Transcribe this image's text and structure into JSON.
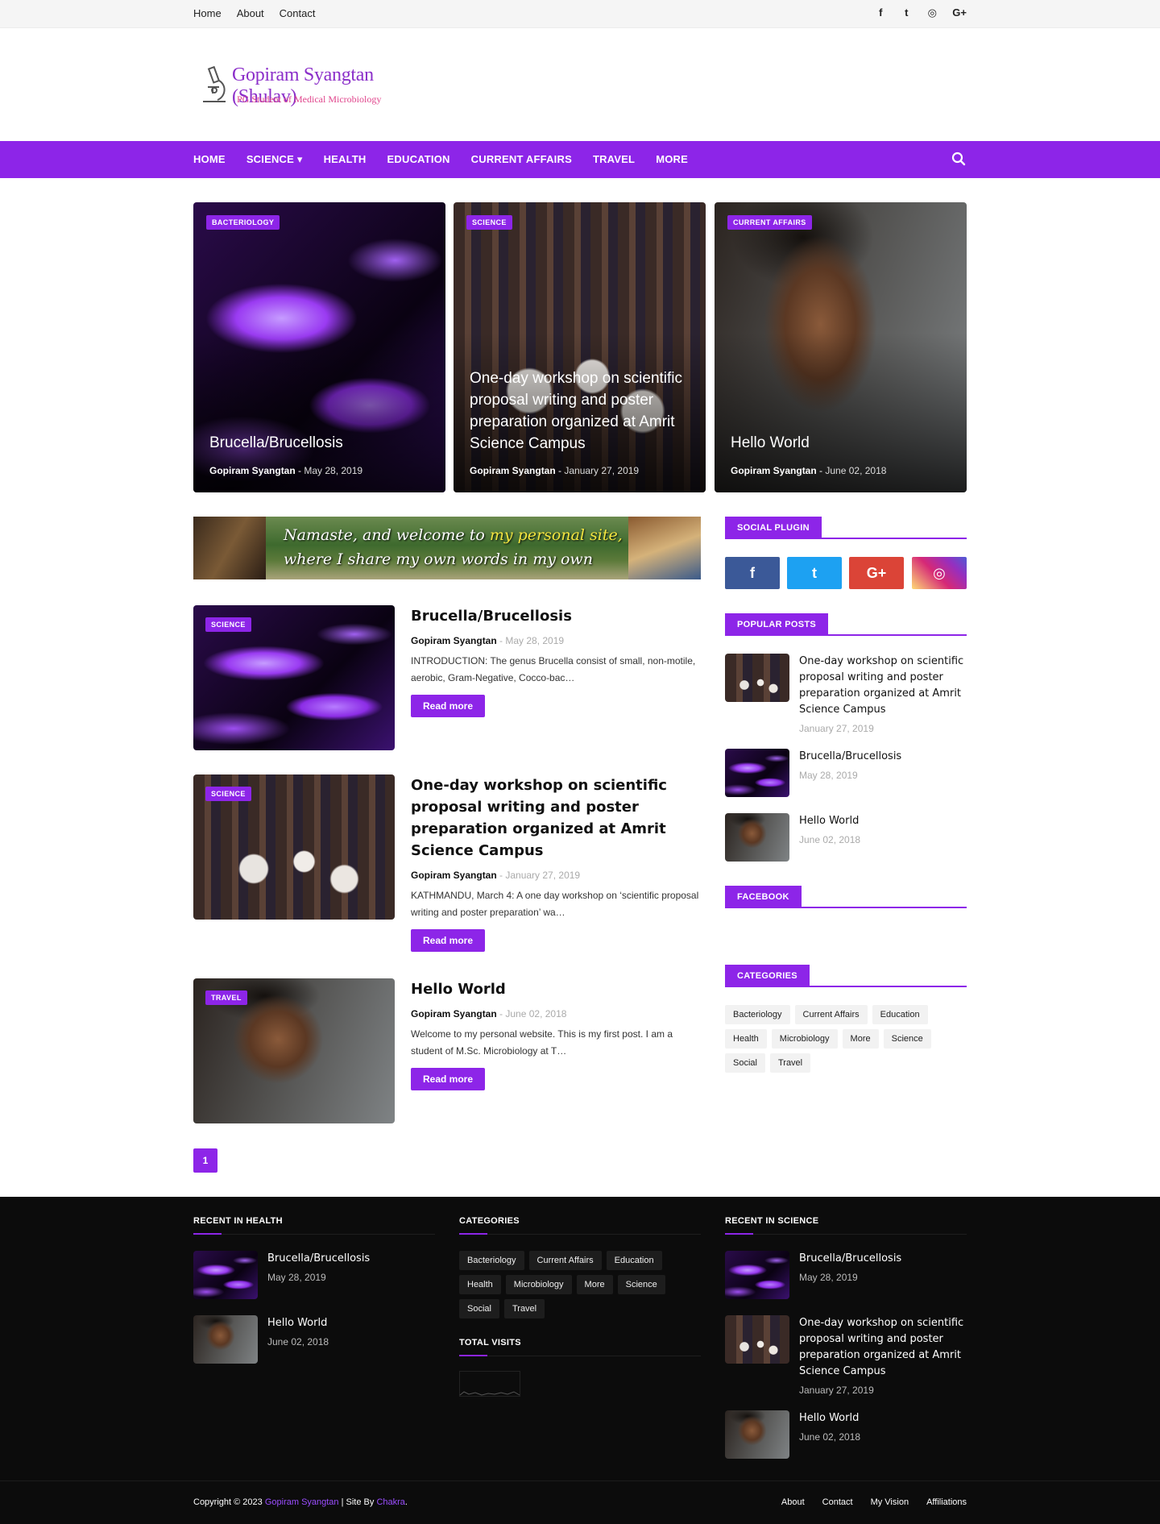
{
  "topbar": {
    "links": [
      "Home",
      "About",
      "Contact"
    ],
    "social_icons": [
      "facebook-icon",
      "twitter-icon",
      "instagram-icon",
      "google-plus-icon"
    ],
    "social_glyphs": [
      "f",
      "t",
      "◎",
      "G+"
    ]
  },
  "logo": {
    "title": "Gopiram Syangtan (Shulav)",
    "subtitle": "PG Student of Medical Microbiology"
  },
  "mainnav": {
    "items": [
      "HOME",
      "SCIENCE",
      "HEALTH",
      "EDUCATION",
      "CURRENT AFFAIRS",
      "TRAVEL",
      "MORE"
    ],
    "science_caret": "▾"
  },
  "featured": [
    {
      "tag": "BACTERIOLOGY",
      "title": "Brucella/Brucellosis",
      "author": "Gopiram Syangtan",
      "date": "May 28, 2019"
    },
    {
      "tag": "SCIENCE",
      "title": "One-day workshop on scientific proposal writing and poster preparation organized at Amrit Science Campus",
      "author": "Gopiram Syangtan",
      "date": "January 27, 2019"
    },
    {
      "tag": "CURRENT AFFAIRS",
      "title": "Hello World",
      "author": "Gopiram Syangtan",
      "date": "June 02, 2018"
    }
  ],
  "banner": {
    "line1": "Namaste, and welcome to",
    "line1_hl": "my personal site,",
    "line2": "where I share my own words in my own way."
  },
  "posts": [
    {
      "tag": "SCIENCE",
      "title": "Brucella/Brucellosis",
      "author": "Gopiram Syangtan",
      "date": "May 28, 2019",
      "excerpt": "INTRODUCTION: The genus Brucella consist of small, non-motile, aerobic, Gram-Negative, Cocco-bac…",
      "read_more": "Read more"
    },
    {
      "tag": "SCIENCE",
      "title": "One-day workshop on scientific proposal writing and poster preparation organized at Amrit Science Campus",
      "author": "Gopiram Syangtan",
      "date": "January 27, 2019",
      "excerpt": "KATHMANDU, March 4:  A one day workshop on ‘scientific proposal writing and poster preparation’ wa…",
      "read_more": "Read more"
    },
    {
      "tag": "TRAVEL",
      "title": "Hello World",
      "author": "Gopiram Syangtan",
      "date": "June 02, 2018",
      "excerpt": "Welcome to my personal website. This is my first post. I am a student of M.Sc. Microbiology at T…",
      "read_more": "Read more"
    }
  ],
  "pager": {
    "current": "1"
  },
  "sidebar": {
    "social_title": "SOCIAL PLUGIN",
    "social_buttons": [
      {
        "icon": "facebook-icon",
        "glyph": "f",
        "color": "#3b5998"
      },
      {
        "icon": "twitter-icon",
        "glyph": "t",
        "color": "#1da1f2"
      },
      {
        "icon": "google-plus-icon",
        "glyph": "G+",
        "color": "#db4437"
      },
      {
        "icon": "instagram-icon",
        "glyph": "◎",
        "color": "#d62976"
      }
    ],
    "popular_title": "POPULAR POSTS",
    "popular": [
      {
        "title": "One-day workshop on scientific proposal writing and poster preparation organized at Amrit Science Campus",
        "date": "January 27, 2019"
      },
      {
        "title": "Brucella/Brucellosis",
        "date": "May 28, 2019"
      },
      {
        "title": "Hello World",
        "date": "June 02, 2018"
      }
    ],
    "facebook_title": "FACEBOOK",
    "categories_title": "CATEGORIES",
    "categories": [
      "Bacteriology",
      "Current Affairs",
      "Education",
      "Health",
      "Microbiology",
      "More",
      "Science",
      "Social",
      "Travel"
    ]
  },
  "footer": {
    "health_title": "RECENT IN HEALTH",
    "health": [
      {
        "title": "Brucella/Brucellosis",
        "date": "May 28, 2019"
      },
      {
        "title": "Hello World",
        "date": "June 02, 2018"
      }
    ],
    "categories_title": "CATEGORIES",
    "categories": [
      "Bacteriology",
      "Current Affairs",
      "Education",
      "Health",
      "Microbiology",
      "More",
      "Science",
      "Social",
      "Travel"
    ],
    "visits_title": "TOTAL VISITS",
    "science_title": "RECENT IN SCIENCE",
    "science": [
      {
        "title": "Brucella/Brucellosis",
        "date": "May 28, 2019"
      },
      {
        "title": "One-day workshop on scientific proposal writing and poster preparation organized at Amrit Science Campus",
        "date": "January 27, 2019"
      },
      {
        "title": "Hello World",
        "date": "June 02, 2018"
      }
    ],
    "copyright_prefix": "Copyright © 2023",
    "copyright_name": "Gopiram Syangtan",
    "copyright_mid": "| Site By",
    "copyright_site": "Chakra",
    "copyright_end": ".",
    "links": [
      "About",
      "Contact",
      "My Vision",
      "Affiliations"
    ]
  },
  "colors": {
    "accent": "#8d25e8",
    "footer_bg": "#0c0c0c"
  }
}
